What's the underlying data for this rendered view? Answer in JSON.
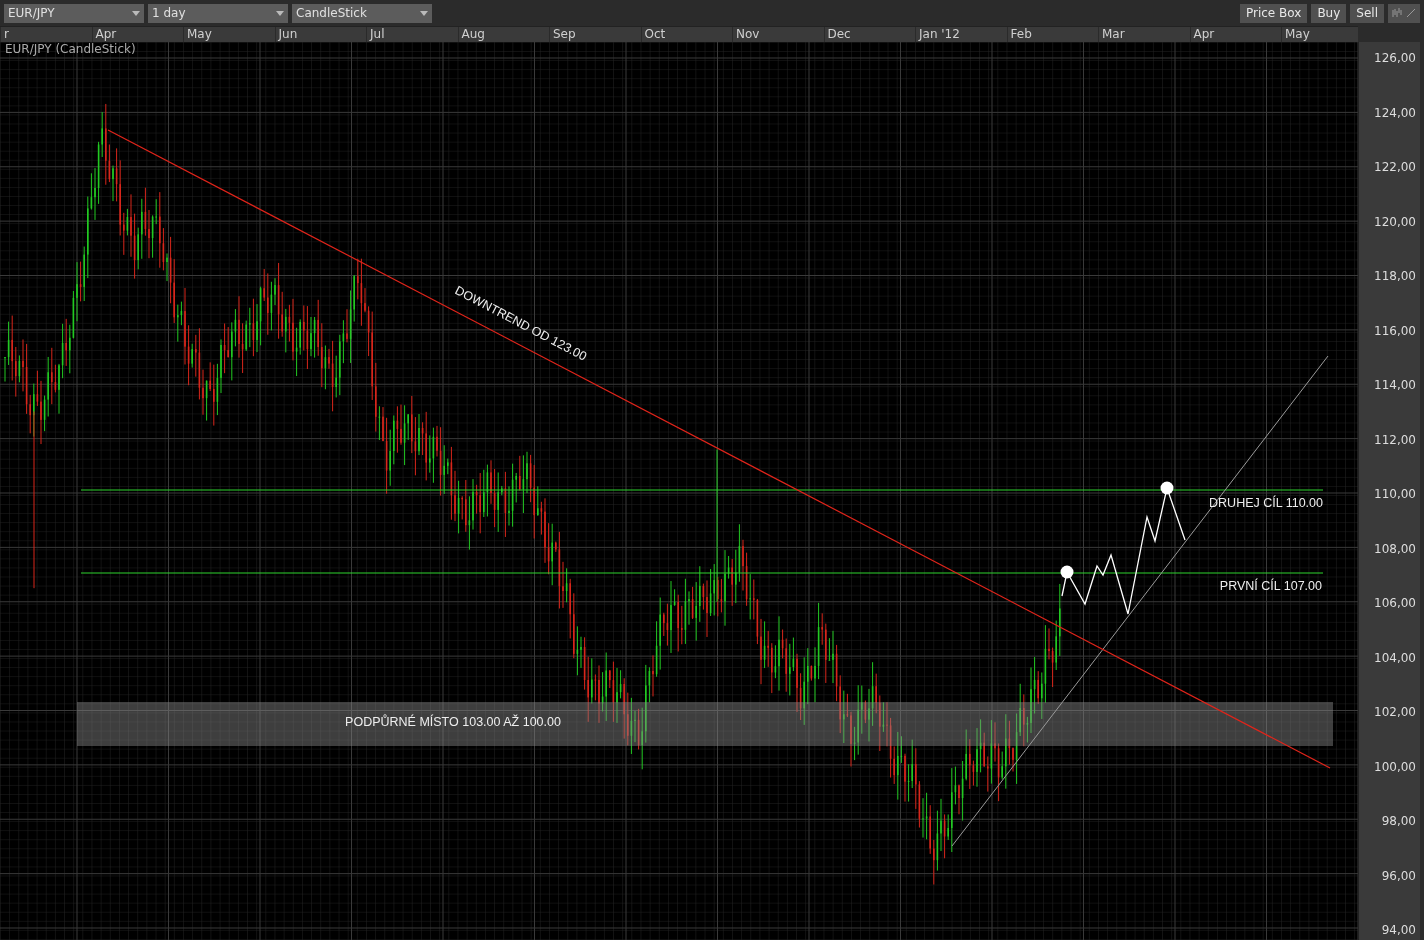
{
  "toolbar": {
    "dropdowns": [
      {
        "value": "EUR/JPY"
      },
      {
        "value": "1 day"
      },
      {
        "value": "CandleStick"
      }
    ],
    "buttons": [
      "Price Box",
      "Buy",
      "Sell"
    ]
  },
  "time_axis": [
    "r",
    "Apr",
    "May",
    "Jun",
    "Jul",
    "Aug",
    "Sep",
    "Oct",
    "Nov",
    "Dec",
    "Jan '12",
    "Feb",
    "Mar",
    "Apr",
    "May"
  ],
  "chart": {
    "title": "EUR/JPY (CandleStick)",
    "annotations": {
      "trend_label": "DOWNTREND OD 123.00",
      "second_target": "DRUHEJ CÍL 110.00",
      "first_target": "PRVNÍ CÍL 107.00",
      "support_zone": "PODPŮRNÉ MÍSTO 103.00 AŽ 100.00"
    },
    "price_axis": [
      "126,00",
      "124,00",
      "122,00",
      "120,00",
      "118,00",
      "116,00",
      "114,00",
      "112,00",
      "110,00",
      "108,00",
      "106,00",
      "104,00",
      "102,00",
      "100,00",
      "98,00",
      "96,00",
      "94,00"
    ]
  }
}
